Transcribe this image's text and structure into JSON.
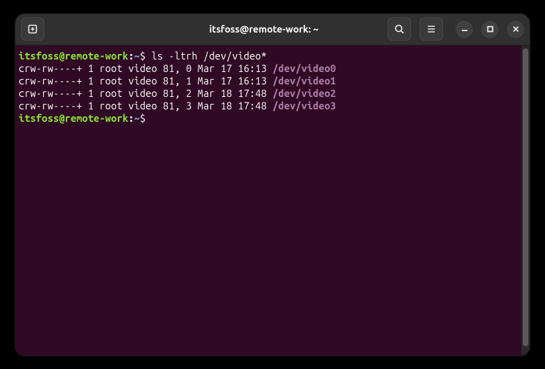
{
  "titlebar": {
    "title": "itsfoss@remote-work: ~"
  },
  "terminal": {
    "prompt": {
      "user_host": "itsfoss@remote-work",
      "separator": ":",
      "cwd": "~",
      "symbol": "$"
    },
    "command": "ls -ltrh /dev/video*",
    "output_lines": [
      {
        "perms_etc": "crw-rw----+ 1 root video 81, 0 Mar 17 16:13 ",
        "device": "/dev/video0"
      },
      {
        "perms_etc": "crw-rw----+ 1 root video 81, 1 Mar 17 16:13 ",
        "device": "/dev/video1"
      },
      {
        "perms_etc": "crw-rw----+ 1 root video 81, 2 Mar 18 17:48 ",
        "device": "/dev/video2"
      },
      {
        "perms_etc": "crw-rw----+ 1 root video 81, 3 Mar 18 17:48 ",
        "device": "/dev/video3"
      }
    ]
  }
}
